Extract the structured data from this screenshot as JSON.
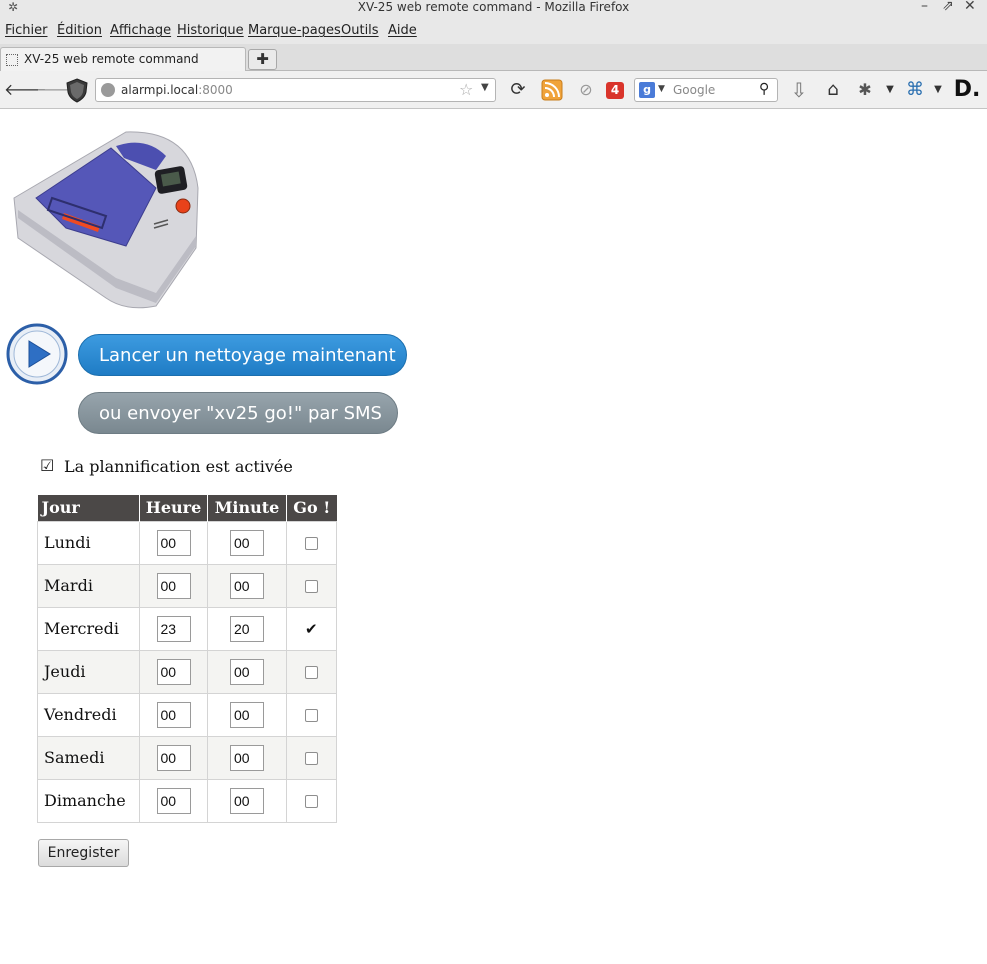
{
  "window": {
    "title": "XV-25 web remote command - Mozilla Firefox",
    "controls": {
      "minimize": "–",
      "maximize": "⇗",
      "close": "✕"
    }
  },
  "menubar": {
    "items": [
      "Fichier",
      "Édition",
      "Affichage",
      "Historique",
      "Marque-pages",
      "Outils",
      "Aide"
    ]
  },
  "tabs": {
    "active_label": "XV-25 web remote command",
    "new_tab_symbol": "✚"
  },
  "navbar": {
    "url_host": "alarmpi.local",
    "url_port": ":8000",
    "search_placeholder": "Google",
    "notification_count": "4"
  },
  "page": {
    "launch_label": "Lancer un nettoyage maintenant",
    "sms_label": "ou envoyer \"xv25 go!\" par SMS",
    "planning_label": "La plannification est activée",
    "planning_enabled": true,
    "save_label": "Enregister",
    "table": {
      "headers": [
        "Jour",
        "Heure",
        "Minute",
        "Go !"
      ],
      "rows": [
        {
          "day": "Lundi",
          "hour": "00",
          "minute": "00",
          "go": false
        },
        {
          "day": "Mardi",
          "hour": "00",
          "minute": "00",
          "go": false
        },
        {
          "day": "Mercredi",
          "hour": "23",
          "minute": "20",
          "go": true
        },
        {
          "day": "Jeudi",
          "hour": "00",
          "minute": "00",
          "go": false
        },
        {
          "day": "Vendredi",
          "hour": "00",
          "minute": "00",
          "go": false
        },
        {
          "day": "Samedi",
          "hour": "00",
          "minute": "00",
          "go": false
        },
        {
          "day": "Dimanche",
          "hour": "00",
          "minute": "00",
          "go": false
        }
      ]
    }
  },
  "colors": {
    "launch_button": "#2a8bd3",
    "sms_button": "#8795a0",
    "table_header": "#4b4847",
    "badge": "#d9342b"
  }
}
